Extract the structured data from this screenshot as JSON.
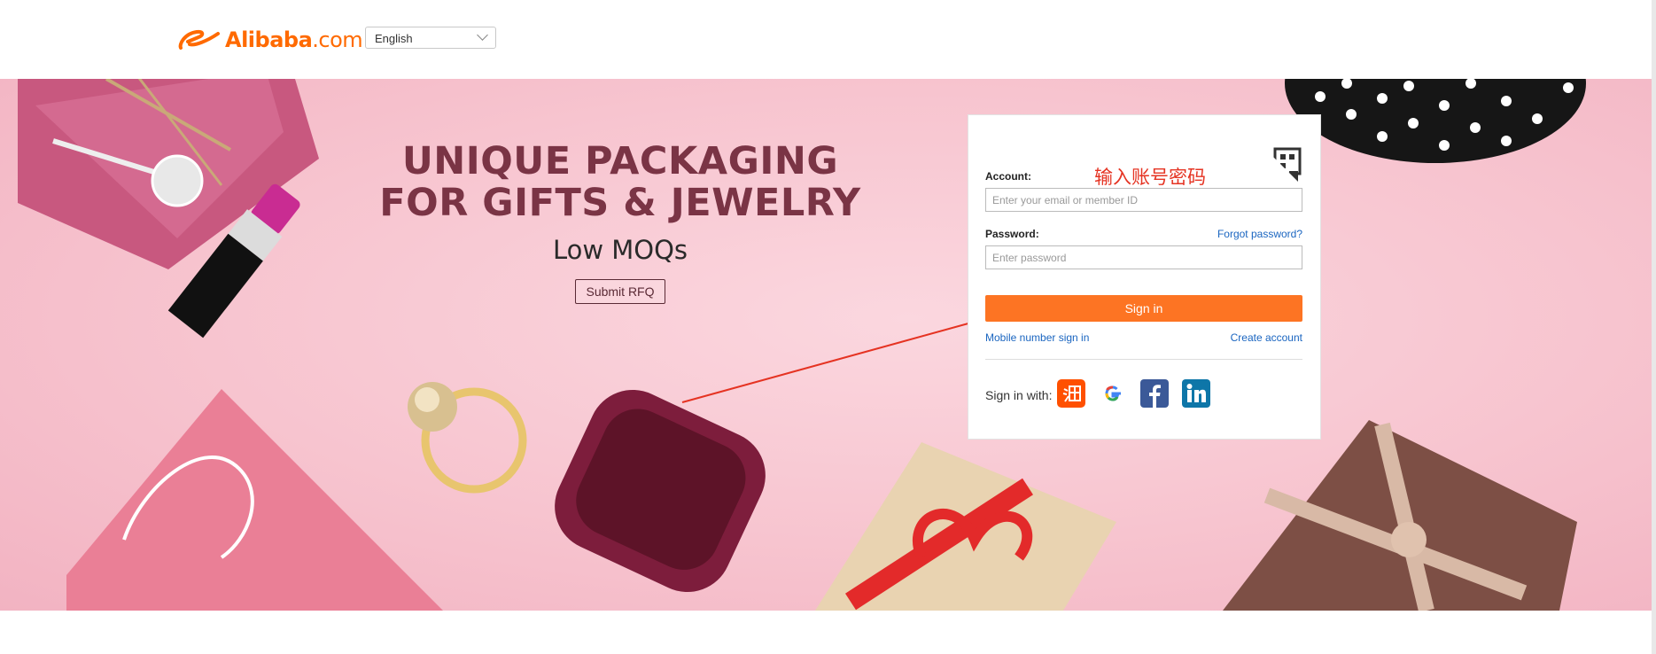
{
  "header": {
    "logo_text": "Alibaba",
    "logo_domain": ".com",
    "language": "English"
  },
  "promo": {
    "title_line1": "UNIQUE PACKAGING",
    "title_line2": "FOR GIFTS & JEWELRY",
    "subtitle": "Low MOQs",
    "button": "Submit RFQ"
  },
  "login": {
    "account_label": "Account:",
    "account_placeholder": "Enter your email or member ID",
    "annotation": "输入账号密码",
    "password_label": "Password:",
    "forgot_link": "Forgot password?",
    "password_placeholder": "Enter password",
    "signin_button": "Sign in",
    "mobile_link": "Mobile number sign in",
    "create_link": "Create account",
    "sign_in_with": "Sign in with:",
    "providers": [
      "taobao",
      "google",
      "facebook",
      "linkedin"
    ]
  },
  "colors": {
    "brand": "#ff6a00",
    "signin": "#fd7423",
    "link": "#1a65c0",
    "annotation": "#e53322"
  }
}
